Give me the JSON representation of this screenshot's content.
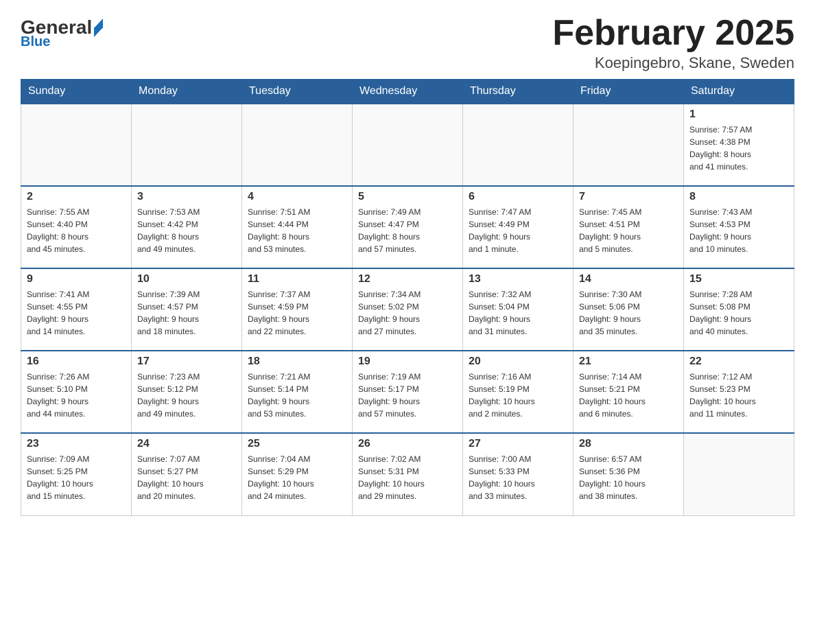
{
  "header": {
    "logo_main": "General",
    "logo_sub": "Blue",
    "month_title": "February 2025",
    "location": "Koepingebro, Skane, Sweden"
  },
  "days_of_week": [
    "Sunday",
    "Monday",
    "Tuesday",
    "Wednesday",
    "Thursday",
    "Friday",
    "Saturday"
  ],
  "weeks": [
    [
      {
        "day": "",
        "info": ""
      },
      {
        "day": "",
        "info": ""
      },
      {
        "day": "",
        "info": ""
      },
      {
        "day": "",
        "info": ""
      },
      {
        "day": "",
        "info": ""
      },
      {
        "day": "",
        "info": ""
      },
      {
        "day": "1",
        "info": "Sunrise: 7:57 AM\nSunset: 4:38 PM\nDaylight: 8 hours\nand 41 minutes."
      }
    ],
    [
      {
        "day": "2",
        "info": "Sunrise: 7:55 AM\nSunset: 4:40 PM\nDaylight: 8 hours\nand 45 minutes."
      },
      {
        "day": "3",
        "info": "Sunrise: 7:53 AM\nSunset: 4:42 PM\nDaylight: 8 hours\nand 49 minutes."
      },
      {
        "day": "4",
        "info": "Sunrise: 7:51 AM\nSunset: 4:44 PM\nDaylight: 8 hours\nand 53 minutes."
      },
      {
        "day": "5",
        "info": "Sunrise: 7:49 AM\nSunset: 4:47 PM\nDaylight: 8 hours\nand 57 minutes."
      },
      {
        "day": "6",
        "info": "Sunrise: 7:47 AM\nSunset: 4:49 PM\nDaylight: 9 hours\nand 1 minute."
      },
      {
        "day": "7",
        "info": "Sunrise: 7:45 AM\nSunset: 4:51 PM\nDaylight: 9 hours\nand 5 minutes."
      },
      {
        "day": "8",
        "info": "Sunrise: 7:43 AM\nSunset: 4:53 PM\nDaylight: 9 hours\nand 10 minutes."
      }
    ],
    [
      {
        "day": "9",
        "info": "Sunrise: 7:41 AM\nSunset: 4:55 PM\nDaylight: 9 hours\nand 14 minutes."
      },
      {
        "day": "10",
        "info": "Sunrise: 7:39 AM\nSunset: 4:57 PM\nDaylight: 9 hours\nand 18 minutes."
      },
      {
        "day": "11",
        "info": "Sunrise: 7:37 AM\nSunset: 4:59 PM\nDaylight: 9 hours\nand 22 minutes."
      },
      {
        "day": "12",
        "info": "Sunrise: 7:34 AM\nSunset: 5:02 PM\nDaylight: 9 hours\nand 27 minutes."
      },
      {
        "day": "13",
        "info": "Sunrise: 7:32 AM\nSunset: 5:04 PM\nDaylight: 9 hours\nand 31 minutes."
      },
      {
        "day": "14",
        "info": "Sunrise: 7:30 AM\nSunset: 5:06 PM\nDaylight: 9 hours\nand 35 minutes."
      },
      {
        "day": "15",
        "info": "Sunrise: 7:28 AM\nSunset: 5:08 PM\nDaylight: 9 hours\nand 40 minutes."
      }
    ],
    [
      {
        "day": "16",
        "info": "Sunrise: 7:26 AM\nSunset: 5:10 PM\nDaylight: 9 hours\nand 44 minutes."
      },
      {
        "day": "17",
        "info": "Sunrise: 7:23 AM\nSunset: 5:12 PM\nDaylight: 9 hours\nand 49 minutes."
      },
      {
        "day": "18",
        "info": "Sunrise: 7:21 AM\nSunset: 5:14 PM\nDaylight: 9 hours\nand 53 minutes."
      },
      {
        "day": "19",
        "info": "Sunrise: 7:19 AM\nSunset: 5:17 PM\nDaylight: 9 hours\nand 57 minutes."
      },
      {
        "day": "20",
        "info": "Sunrise: 7:16 AM\nSunset: 5:19 PM\nDaylight: 10 hours\nand 2 minutes."
      },
      {
        "day": "21",
        "info": "Sunrise: 7:14 AM\nSunset: 5:21 PM\nDaylight: 10 hours\nand 6 minutes."
      },
      {
        "day": "22",
        "info": "Sunrise: 7:12 AM\nSunset: 5:23 PM\nDaylight: 10 hours\nand 11 minutes."
      }
    ],
    [
      {
        "day": "23",
        "info": "Sunrise: 7:09 AM\nSunset: 5:25 PM\nDaylight: 10 hours\nand 15 minutes."
      },
      {
        "day": "24",
        "info": "Sunrise: 7:07 AM\nSunset: 5:27 PM\nDaylight: 10 hours\nand 20 minutes."
      },
      {
        "day": "25",
        "info": "Sunrise: 7:04 AM\nSunset: 5:29 PM\nDaylight: 10 hours\nand 24 minutes."
      },
      {
        "day": "26",
        "info": "Sunrise: 7:02 AM\nSunset: 5:31 PM\nDaylight: 10 hours\nand 29 minutes."
      },
      {
        "day": "27",
        "info": "Sunrise: 7:00 AM\nSunset: 5:33 PM\nDaylight: 10 hours\nand 33 minutes."
      },
      {
        "day": "28",
        "info": "Sunrise: 6:57 AM\nSunset: 5:36 PM\nDaylight: 10 hours\nand 38 minutes."
      },
      {
        "day": "",
        "info": ""
      }
    ]
  ]
}
